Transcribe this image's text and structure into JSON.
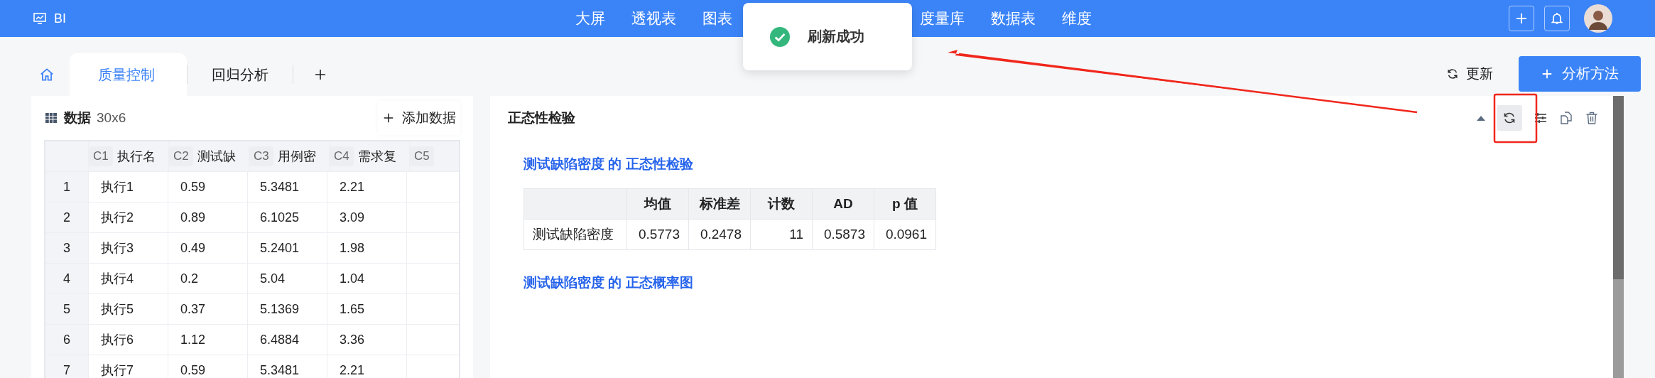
{
  "app": {
    "title": "BI"
  },
  "nav": [
    {
      "label": "大屏"
    },
    {
      "label": "透视表"
    },
    {
      "label": "图表"
    },
    {
      "label": "度量库"
    },
    {
      "label": "数据表"
    },
    {
      "label": "维度"
    }
  ],
  "toast": {
    "message": "刷新成功"
  },
  "tabs": [
    {
      "label": "质量控制",
      "selected": true
    },
    {
      "label": "回归分析",
      "selected": false
    }
  ],
  "toolbar": {
    "refresh": "更新",
    "primary": "分析方法"
  },
  "data_panel": {
    "title": "数据",
    "size": "30x6",
    "add_button": "添加数据",
    "columns": [
      {
        "code": "C1",
        "name": "执行名"
      },
      {
        "code": "C2",
        "name": "测试缺"
      },
      {
        "code": "C3",
        "name": "用例密"
      },
      {
        "code": "C4",
        "name": "需求复"
      },
      {
        "code": "C5"
      }
    ],
    "rows": [
      {
        "index": "1",
        "cells": [
          "执行1",
          "0.59",
          "5.3481",
          "2.21"
        ]
      },
      {
        "index": "2",
        "cells": [
          "执行2",
          "0.89",
          "6.1025",
          "3.09"
        ]
      },
      {
        "index": "3",
        "cells": [
          "执行3",
          "0.49",
          "5.2401",
          "1.98"
        ]
      },
      {
        "index": "4",
        "cells": [
          "执行4",
          "0.2",
          "5.04",
          "1.04"
        ]
      },
      {
        "index": "5",
        "cells": [
          "执行5",
          "0.37",
          "5.1369",
          "1.65"
        ]
      },
      {
        "index": "6",
        "cells": [
          "执行6",
          "1.12",
          "6.4884",
          "3.36"
        ]
      },
      {
        "index": "7",
        "cells": [
          "执行7",
          "0.59",
          "5.3481",
          "2.21"
        ]
      }
    ]
  },
  "result_panel": {
    "title": "正态性检验",
    "section_heading": "测试缺陷密度 的 正态性检验",
    "stats_columns": [
      "均值",
      "标准差",
      "计数",
      "AD",
      "p 值"
    ],
    "stats_rows": [
      {
        "label": "测试缺陷密度",
        "values": [
          "0.5773",
          "0.2478",
          "11",
          "0.5873",
          "0.0961"
        ]
      }
    ],
    "plot_heading": "测试缺陷密度 的 正态概率图"
  }
}
